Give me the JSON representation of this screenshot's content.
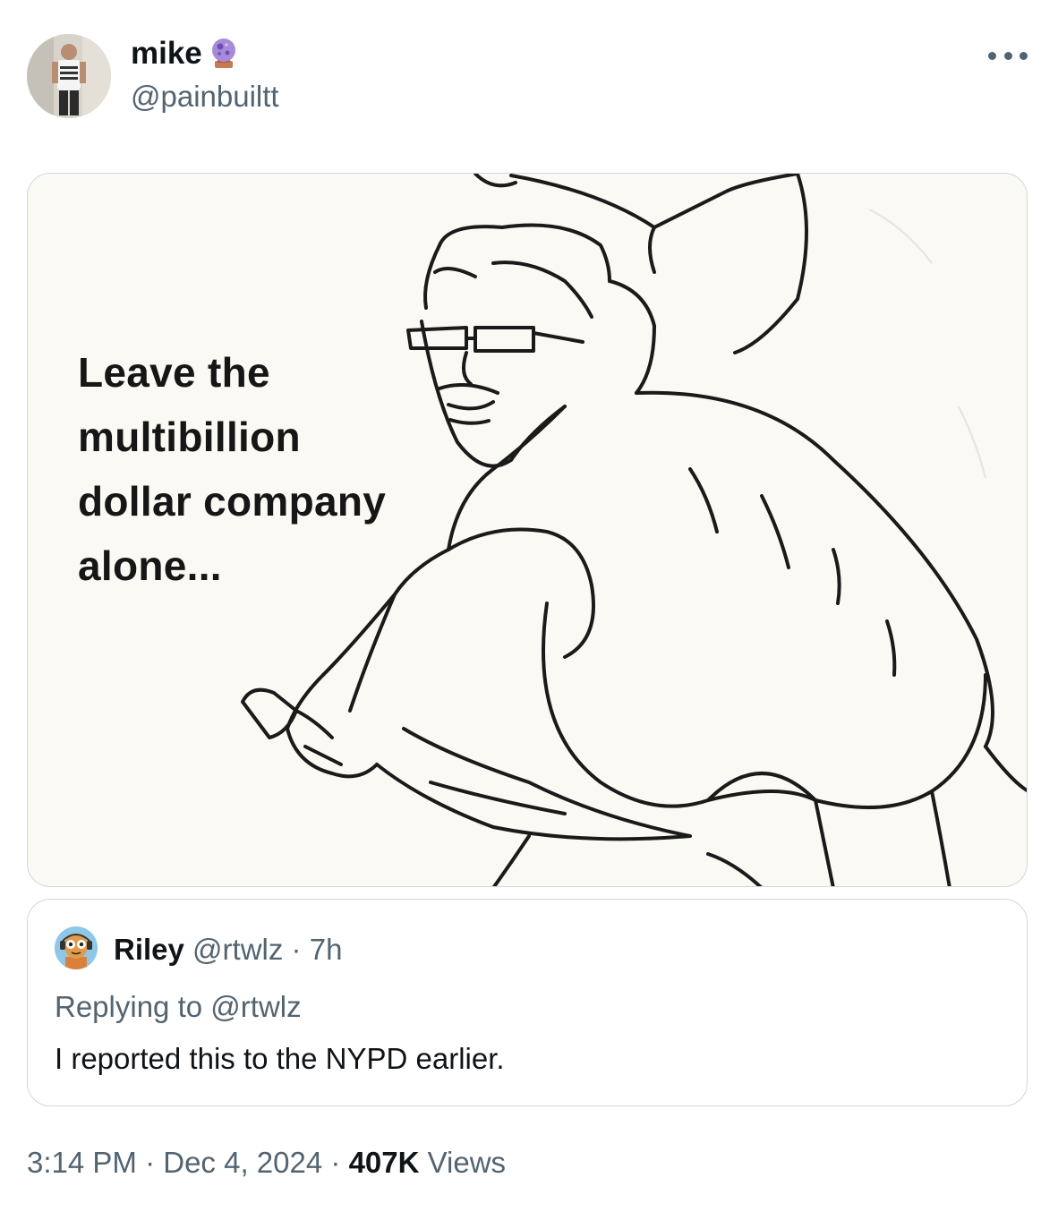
{
  "author": {
    "display_name": "mike",
    "emoji_icon": "crystal-ball-icon",
    "handle": "@painbuiltt",
    "avatar_icon": "profile-photo"
  },
  "more_icon": "more-options-icon",
  "media": {
    "caption_lines": [
      "Leave the",
      "multibillion",
      "dollar company",
      "alone..."
    ],
    "kind": "meme-drawing"
  },
  "quoted_tweet": {
    "display_name": "Riley",
    "handle": "@rtwlz",
    "separator": "·",
    "time": "7h",
    "replying_prefix": "Replying to",
    "replying_handle": "@rtwlz",
    "text": "I reported this to the NYPD earlier.",
    "avatar_icon": "cartoon-avatar"
  },
  "footer": {
    "time": "3:14 PM",
    "separator": "·",
    "date": "Dec 4, 2024",
    "views_count": "407K",
    "views_label": "Views"
  },
  "colors": {
    "text_primary": "#0f1419",
    "text_secondary": "#536471",
    "border": "#cfd9de"
  }
}
